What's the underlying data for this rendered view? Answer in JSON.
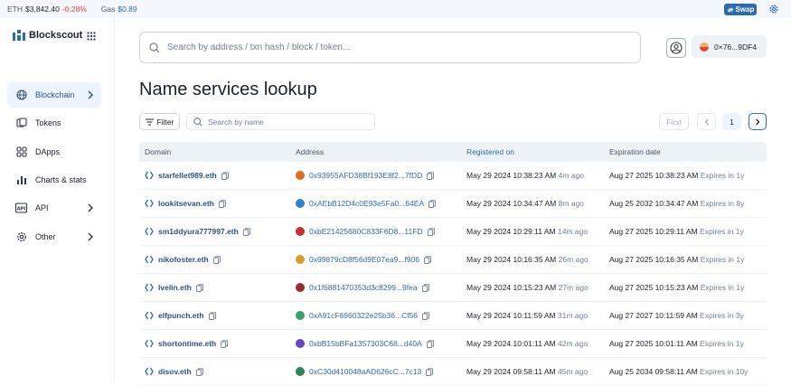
{
  "topbar": {
    "eth_label": "ETH",
    "eth_price": "$3,842.40",
    "eth_change": "-0.28%",
    "gas_label": "Gas",
    "gas_price": "$0.89",
    "swap_label": "Swap"
  },
  "sidebar": {
    "logo_text": "Blockscout",
    "items": [
      {
        "label": "Blockchain",
        "icon": "globe-icon",
        "active": true,
        "has_chevron": true
      },
      {
        "label": "Tokens",
        "icon": "tokens-icon",
        "active": false,
        "has_chevron": false
      },
      {
        "label": "DApps",
        "icon": "apps-icon",
        "active": false,
        "has_chevron": false
      },
      {
        "label": "Charts & stats",
        "icon": "stats-icon",
        "active": false,
        "has_chevron": false
      },
      {
        "label": "API",
        "icon": "api-icon",
        "active": false,
        "has_chevron": true
      },
      {
        "label": "Other",
        "icon": "gear-icon",
        "active": false,
        "has_chevron": true
      }
    ]
  },
  "header": {
    "search_placeholder": "Search by address / txn hash / block / token...",
    "wallet_address": "0×76...9DF4"
  },
  "page_title": "Name services lookup",
  "filters": {
    "filter_label": "Filter",
    "name_search_placeholder": "Search by name"
  },
  "pagination": {
    "first_label": "First",
    "current_page": "1"
  },
  "table": {
    "columns": [
      "Domain",
      "Address",
      "Registered on",
      "Expiration date"
    ],
    "rows": [
      {
        "domain": "starfellet989.eth",
        "address": "0x93955AFD38Bf193E8f2...7fDD",
        "addr_color": "#dd6b20",
        "registered": "May 29 2024 10:38:23 AM",
        "reg_ago": "4m ago",
        "expires": "Aug 27 2025 10:38:23 AM",
        "expires_in": "Expires in 1y"
      },
      {
        "domain": "lookitsevan.eth",
        "address": "0xAEbB12D4c0E93e5Fa0...64EA",
        "addr_color": "#3182ce",
        "registered": "May 29 2024 10:34:47 AM",
        "reg_ago": "8m ago",
        "expires": "Aug 25 2032 10:34:47 AM",
        "expires_in": "Expires in 8y"
      },
      {
        "domain": "sm1ddyura777997.eth",
        "address": "0xbE21425680C833F6D8...11FD",
        "addr_color": "#c53030",
        "registered": "May 29 2024 10:29:11 AM",
        "reg_ago": "14m ago",
        "expires": "Aug 27 2025 10:29:11 AM",
        "expires_in": "Expires in 1y"
      },
      {
        "domain": "nikofoster.eth",
        "address": "0x99879cD8f56d9E07ea9...f906",
        "addr_color": "#d69e2e",
        "registered": "May 29 2024 10:16:35 AM",
        "reg_ago": "26m ago",
        "expires": "Aug 27 2025 10:16:35 AM",
        "expires_in": "Expires in 1y"
      },
      {
        "domain": "lvelin.eth",
        "address": "0x1f6881470353d3c8299...9fea",
        "addr_color": "#9b2c2c",
        "registered": "May 29 2024 10:15:23 AM",
        "reg_ago": "27m ago",
        "expires": "Aug 27 2025 10:15:23 AM",
        "expires_in": "Expires in 1y"
      },
      {
        "domain": "elfpunch.eth",
        "address": "0xA91cF6960322e25b36...Cf56",
        "addr_color": "#38a169",
        "registered": "May 29 2024 10:11:59 AM",
        "reg_ago": "31m ago",
        "expires": "Aug 27 2027 10:11:59 AM",
        "expires_in": "Expires in 3y"
      },
      {
        "domain": "shortontime.eth",
        "address": "0xbB15bBFa1357303C68...d40A",
        "addr_color": "#6b46c1",
        "registered": "May 29 2024 10:01:11 AM",
        "reg_ago": "42m ago",
        "expires": "Aug 27 2025 10:01:11 AM",
        "expires_in": "Expires in 1y"
      },
      {
        "domain": "disov.eth",
        "address": "0xC30d410048aAD626cC...7c13",
        "addr_color": "#2f855a",
        "registered": "May 29 2024 09:58:11 AM",
        "reg_ago": "45m ago",
        "expires": "Aug 25 2034 09:58:11 AM",
        "expires_in": "Expires in 10y"
      }
    ]
  }
}
